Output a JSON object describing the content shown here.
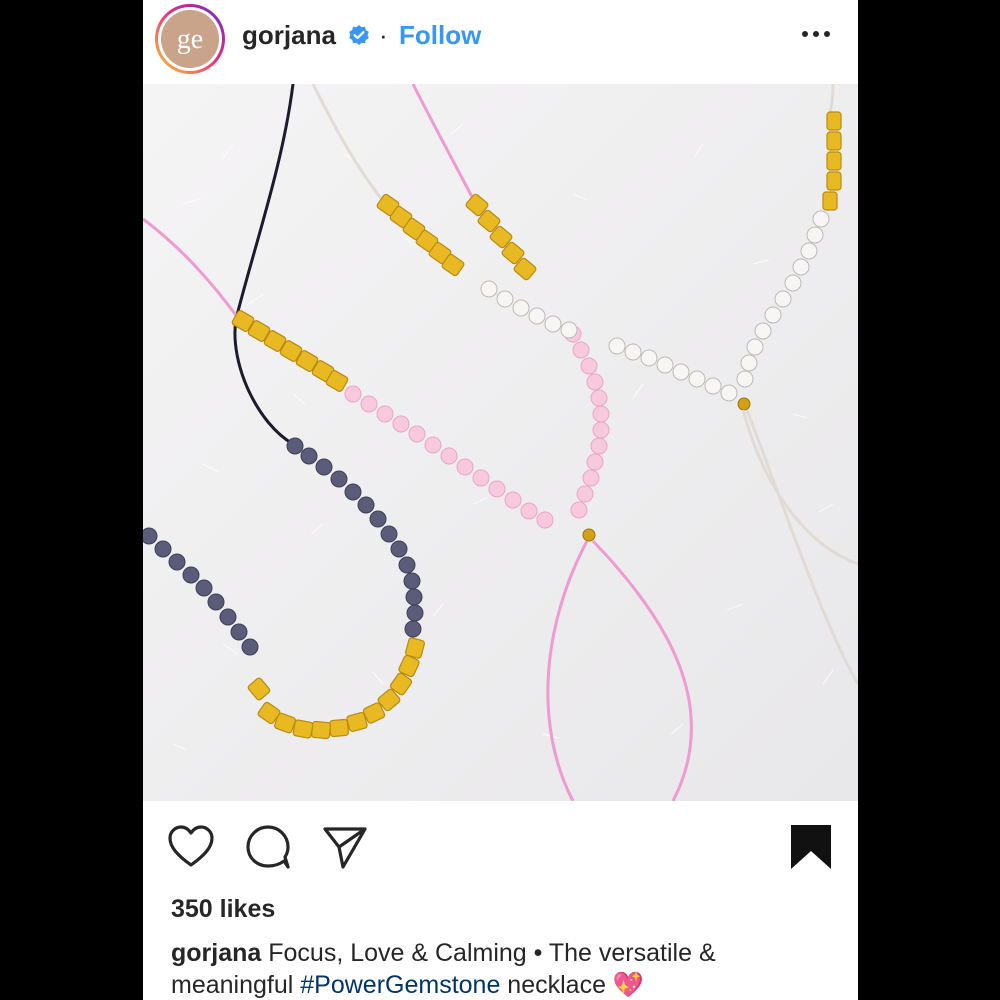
{
  "post": {
    "username": "gorjana",
    "verified": true,
    "separator": "·",
    "follow_label": "Follow",
    "avatar_text": "ge",
    "likes": "350 likes",
    "caption": {
      "username": "gorjana",
      "text_line1": " Focus, Love & Calming • The versatile &",
      "text_line2_prefix": "meaningful ",
      "hashtag": "#PowerGemstone",
      "text_line2_suffix": " necklace ",
      "emoji": "💖"
    }
  },
  "icons": {
    "like": "heart-icon",
    "comment": "comment-icon",
    "share": "paper-plane-icon",
    "save": "bookmark-icon",
    "more": "more-dots-icon",
    "verified": "verified-badge-icon"
  },
  "colors": {
    "link_blue": "#3897f0",
    "hashtag": "#003569",
    "text": "#262626",
    "verified": "#3897f0"
  }
}
